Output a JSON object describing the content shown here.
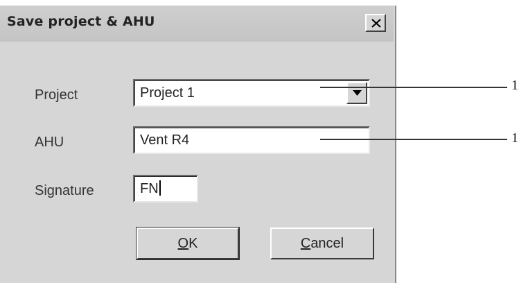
{
  "dialog": {
    "title": "Save project & AHU",
    "close_icon": "close-icon"
  },
  "form": {
    "project_label": "Project",
    "project_value": "Project 1",
    "ahu_label": "AHU",
    "ahu_value": "Vent R4",
    "signature_label": "Signature",
    "signature_value": "FN"
  },
  "buttons": {
    "ok_mnemonic": "O",
    "ok_rest": "K",
    "cancel_mnemonic": "C",
    "cancel_rest": "ancel"
  },
  "callouts": {
    "project_callout": "1",
    "ahu_callout": "1"
  }
}
